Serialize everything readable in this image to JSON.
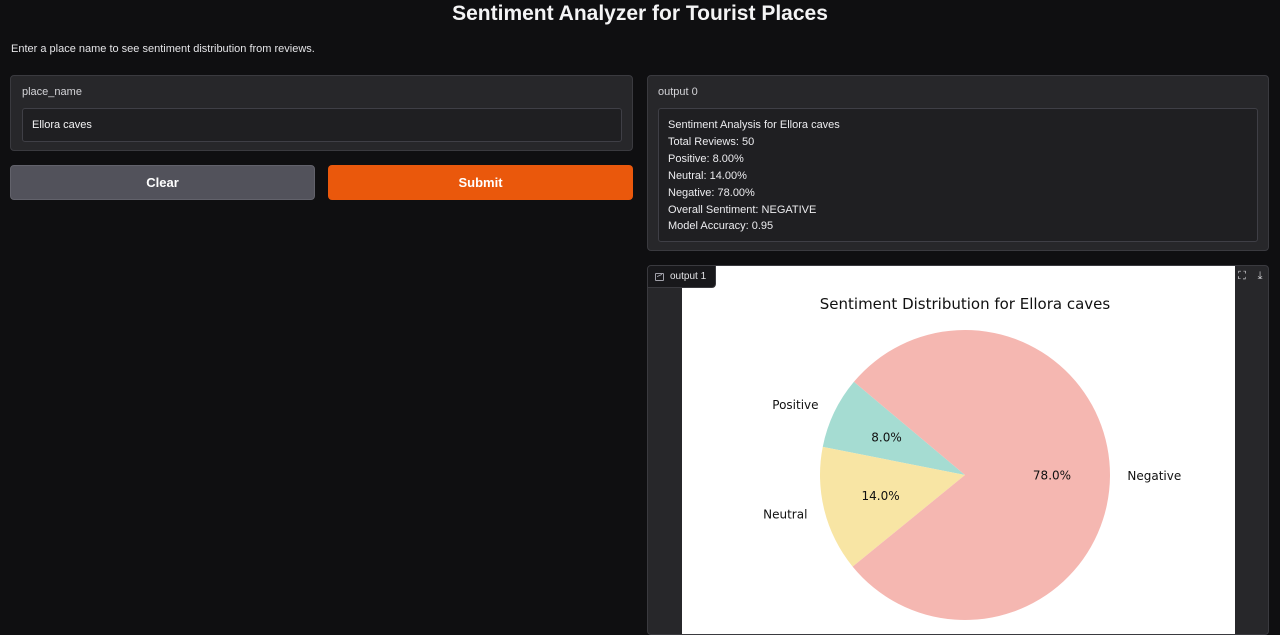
{
  "page": {
    "title": "Sentiment Analyzer for Tourist Places",
    "description": "Enter a place name to see sentiment distribution from reviews."
  },
  "input": {
    "label": "place_name",
    "value": "Ellora caves"
  },
  "buttons": {
    "clear_label": "Clear",
    "submit_label": "Submit"
  },
  "output0": {
    "label": "output 0",
    "lines": [
      "Sentiment Analysis for Ellora caves",
      "Total Reviews: 50",
      "Positive: 8.00%",
      "Neutral: 14.00%",
      "Negative: 78.00%",
      "Overall Sentiment: NEGATIVE",
      "Model Accuracy: 0.95"
    ]
  },
  "output1": {
    "label": "output 1",
    "icons": [
      "image-icon",
      "fullscreen-icon",
      "download-icon"
    ]
  },
  "colors": {
    "accent": "#ea580c",
    "positive": "#a5dcd2",
    "neutral": "#f8e5a4",
    "negative": "#f5b7b1"
  },
  "chart_data": {
    "type": "pie",
    "title": "Sentiment Distribution for Ellora caves",
    "categories": [
      "Positive",
      "Neutral",
      "Negative"
    ],
    "values": [
      8.0,
      14.0,
      78.0
    ],
    "pct_labels": [
      "8.0%",
      "14.0%",
      "78.0%"
    ],
    "colors": [
      "#a5dcd2",
      "#f8e5a4",
      "#f5b7b1"
    ],
    "start_angle_deg": 140,
    "direction": "counterclockwise"
  }
}
